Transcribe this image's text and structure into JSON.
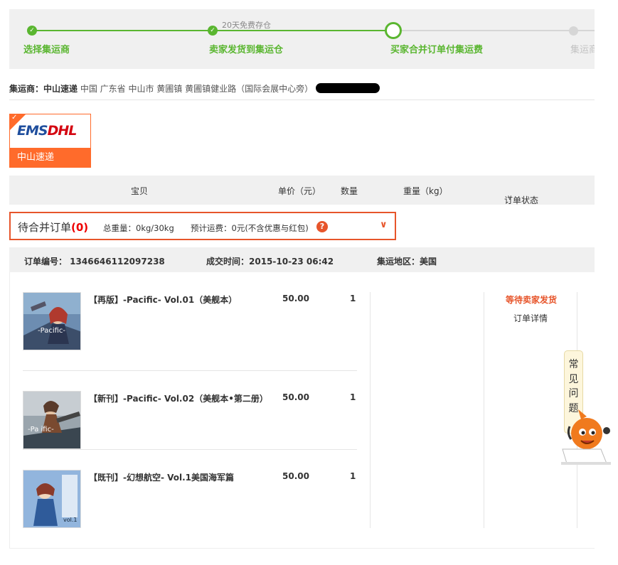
{
  "steps": [
    {
      "label": "选择集运商",
      "state": "done"
    },
    {
      "label": "卖家发货到集运仓",
      "state": "done",
      "note": "20天免费存仓"
    },
    {
      "label": "买家合并订单付集运费",
      "state": "active"
    },
    {
      "label": "集运商",
      "state": "todo"
    }
  ],
  "consolidator": {
    "label": "集运商：",
    "name": "中山速递",
    "address": "中国 广东省 中山市 黄圃镇 黄圃镇健业路（国际会展中心旁）"
  },
  "carrier": {
    "logo_ems": "EMS",
    "logo_dhl": "DHL",
    "name": "中山速递",
    "selected": true
  },
  "table_header": {
    "item": "宝贝",
    "price": "单价（元）",
    "qty": "数量",
    "weight": "重量（kg）",
    "status": "订单状态"
  },
  "pending": {
    "title": "待合并订单",
    "count": "(0)",
    "total_weight": "总重量：0kg/30kg",
    "est_fee": "预计运费：0元(不含优惠与红包)"
  },
  "order": {
    "number": "订单编号： 1346646112097238",
    "time": "成交时间：2015-10-23 06:42",
    "region": "集运地区：美国",
    "status": "等待卖家发货",
    "detail": "订单详情",
    "items": [
      {
        "name": "【再版】-Pacific- Vol.01（美舰本）",
        "price": "50.00",
        "qty": "1",
        "thumb_text": "-Pacific-"
      },
      {
        "name": "【新刊】-Pacific- Vol.02（美舰本•第二册）",
        "price": "50.00",
        "qty": "1",
        "thumb_text": "-Pa  ific-"
      },
      {
        "name": "【既刊】-幻想航空- Vol.1美国海军篇",
        "price": "50.00",
        "qty": "1",
        "thumb_text": "vol.1"
      }
    ]
  },
  "faq": {
    "chars": [
      "常",
      "见",
      "问",
      "题"
    ]
  },
  "colors": {
    "green": "#5ab630",
    "orange": "#e7552b",
    "carrier_orange": "#ff6b2b",
    "header_gray": "#f0f0f0"
  }
}
